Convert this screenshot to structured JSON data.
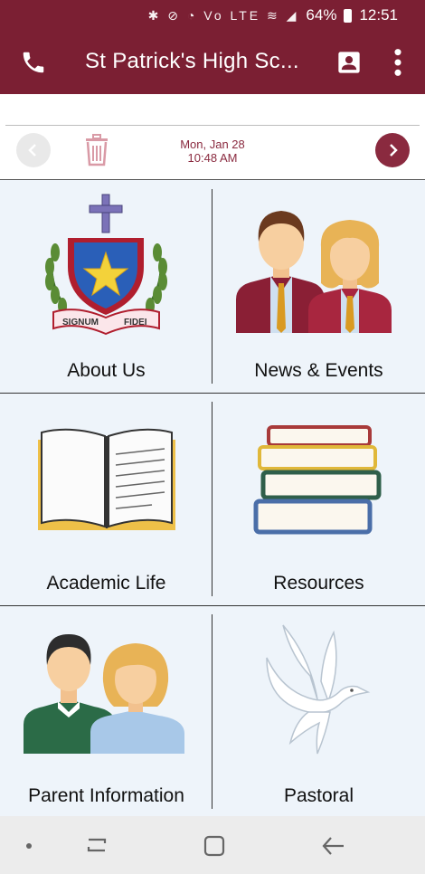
{
  "status": {
    "battery": "64%",
    "time": "12:51",
    "icons": "✱ ⊘ ◔ Vo LTE ≋ ◢"
  },
  "appbar": {
    "title": "St Patrick's High Sc...",
    "phone_icon": "phone-icon",
    "contact_icon": "contact-card-icon",
    "more_icon": "more-vert-icon"
  },
  "datebar": {
    "day": "Mon, Jan 28",
    "time": "10:48 AM"
  },
  "tiles": [
    {
      "label": "About Us",
      "icon": "school-crest-icon"
    },
    {
      "label": "News & Events",
      "icon": "students-icon"
    },
    {
      "label": "Academic Life",
      "icon": "open-book-icon"
    },
    {
      "label": "Resources",
      "icon": "book-stack-icon"
    },
    {
      "label": "Parent Information",
      "icon": "parents-icon"
    },
    {
      "label": "Pastoral",
      "icon": "dove-icon"
    }
  ],
  "crest": {
    "left": "SIGNUM",
    "right": "FIDEI"
  },
  "colors": {
    "brand": "#7b1f33",
    "tile_bg": "#eef4fa",
    "nav_bg": "#ececec"
  }
}
